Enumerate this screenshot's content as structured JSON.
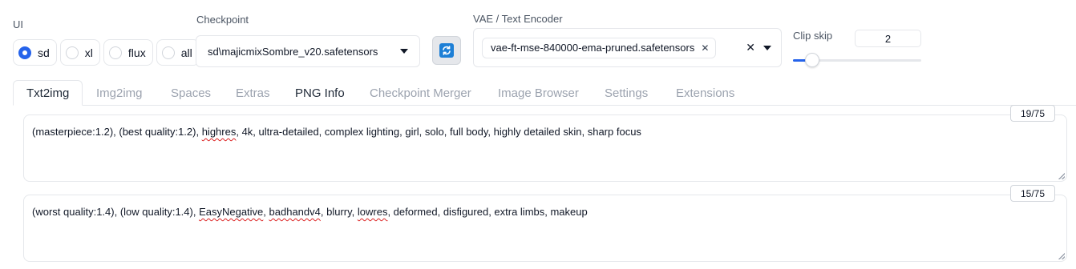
{
  "top": {
    "ui_label": "UI",
    "ui_options": [
      {
        "label": "sd",
        "checked": true
      },
      {
        "label": "xl",
        "checked": false
      },
      {
        "label": "flux",
        "checked": false
      },
      {
        "label": "all",
        "checked": false
      }
    ],
    "checkpoint_label": "Checkpoint",
    "checkpoint_value": "sd\\majicmixSombre_v20.safetensors",
    "refresh_icon": "refresh-icon",
    "vae_label": "VAE / Text Encoder",
    "vae_chip": "vae-ft-mse-840000-ema-pruned.safetensors",
    "clip_skip_label": "Clip skip",
    "clip_skip_value": "2",
    "clip_skip_fraction": 0.08
  },
  "tabs": [
    {
      "label": "Txt2img",
      "active": true
    },
    {
      "label": "Img2img"
    },
    {
      "label": "Spaces"
    },
    {
      "label": "Extras"
    },
    {
      "label": "PNG Info",
      "dark": true
    },
    {
      "label": "Checkpoint Merger"
    },
    {
      "label": "Image Browser"
    },
    {
      "label": "Settings"
    },
    {
      "label": "Extensions"
    }
  ],
  "prompt": {
    "counter": "19/75",
    "text_before": "(masterpiece:1.2), (best quality:1.2), ",
    "text_flag": "highres",
    "text_after": ", 4k, ultra-detailed, complex lighting, girl, solo, full body, highly detailed skin, sharp focus"
  },
  "negative": {
    "counter": "15/75",
    "t1": "(worst quality:1.4), (low quality:1.4), ",
    "f1": "EasyNegative",
    "t2": ", ",
    "f2": "badhandv4",
    "t3": ", blurry, ",
    "f3": "lowres",
    "t4": ", deformed, disfigured, extra limbs, makeup"
  },
  "colors": {
    "accent": "#2563eb",
    "border": "#e5e7eb",
    "muted_tab": "#9ca3af"
  }
}
